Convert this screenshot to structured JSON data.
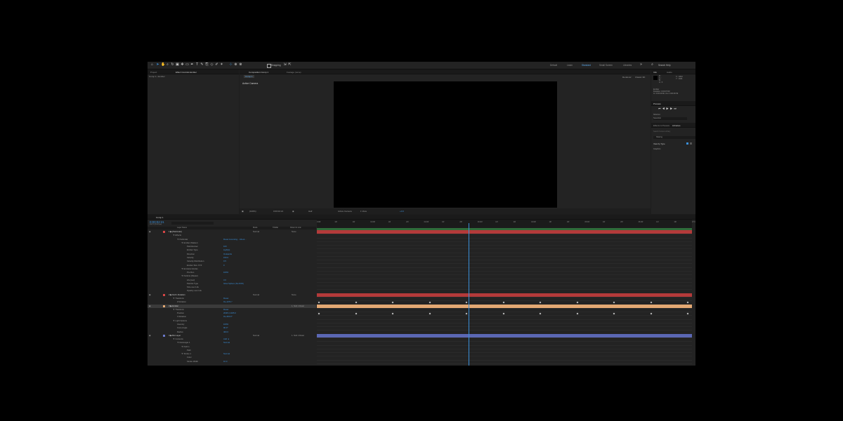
{
  "workspaces": [
    "Default",
    "Learn",
    "Standard",
    "Small Screen",
    "Libraries"
  ],
  "workspace_active": "Standard",
  "search_help": "Search Help",
  "snapping_label": "Snapping",
  "left_panel": {
    "tab_project": "Project",
    "tab_effect_controls": "Effect Controls Emitter",
    "breadcrumb": "Comp 1 • Emitter"
  },
  "comp_panel": {
    "tab_comp": "Composition Comp 1",
    "tab_footage": "Footage (none)",
    "comp_chip": "Comp 1",
    "active_camera": "Active Camera",
    "renderer_label": "Renderer:",
    "renderer_value": "Classic 3D",
    "zoom": "(100%)",
    "timecode": "0:00:02:21",
    "resolution": "Half",
    "view": "Active Camera",
    "views": "1 View",
    "exposure": "+0.0"
  },
  "right_panel": {
    "tab_info": "Info",
    "tab_audio": "Audio",
    "info_r": "R :",
    "info_g": "G :",
    "info_b": "B :",
    "info_a": "A : 0",
    "info_x": "X : 1824",
    "info_y": "Y : 1601",
    "info_name": "Emitter",
    "info_duration": "Duration: 0:00:07:00",
    "info_inout": "In: 0:00:00:00, Out: 0:00:06:59",
    "tab_preview": "Preview",
    "shortcut_label": "Shortcut",
    "shortcut_value": "Spacebar",
    "tab_fx": "Effects & Presets",
    "tab_libraries": "Libraries",
    "lib_search": "Search Current Library",
    "lib_name": "Sharing",
    "view_by": "View by Type",
    "lib_section": "Graphics"
  },
  "timeline": {
    "tab": "Comp 1",
    "timecode": "0:00:02:21",
    "fps": "00071 (25.00 fps)",
    "search_placeholder": "",
    "col_source": "Layer Name",
    "col_mode": "Mode",
    "col_trkmat": "TrkMat",
    "col_parent": "Parent & Link",
    "ruler": [
      "0:00f",
      "10f",
      "20f",
      "01:00f",
      "10f",
      "20f",
      "02:00f",
      "10f",
      "20f",
      "03:00f",
      "10f",
      "20f",
      "04:00f",
      "10f",
      "20f",
      "05:00f",
      "10f",
      "20f",
      "06:00f",
      "10f",
      "20f",
      "07:0"
    ],
    "rows": [
      {
        "indent": 8,
        "label": "1  ▶ [Particular]",
        "value": "",
        "mode": "Normal",
        "parent": "None",
        "color": "#d64545",
        "layer": true
      },
      {
        "indent": 14,
        "label": "▼ Effects",
        "value": ""
      },
      {
        "indent": 20,
        "label": "▼ Particular",
        "value": "Reset   Licensing...   About..."
      },
      {
        "indent": 26,
        "label": "▼ Emitter (Master)",
        "value": ""
      },
      {
        "indent": 34,
        "label": "Particles/sec",
        "value": "100"
      },
      {
        "indent": 34,
        "label": "Emitter Type",
        "value": "Light(s)"
      },
      {
        "indent": 34,
        "label": "Direction",
        "value": "Outwards"
      },
      {
        "indent": 34,
        "label": "Velocity",
        "value": "150.0"
      },
      {
        "indent": 34,
        "label": "Velocity Distribution",
        "value": "0.5"
      },
      {
        "indent": 34,
        "label": "Emitter Size XYZ",
        "value": "0"
      },
      {
        "indent": 26,
        "label": "▼ Emission Extras",
        "value": ""
      },
      {
        "indent": 34,
        "label": "Pre Run",
        "value": "100%"
      },
      {
        "indent": 26,
        "label": "▼ Particle (Master)",
        "value": ""
      },
      {
        "indent": 34,
        "label": "Life [sec]",
        "value": "3.0"
      },
      {
        "indent": 34,
        "label": "Particle Type",
        "value": "Glow Sphere (No DOF)"
      },
      {
        "indent": 34,
        "label": "Size over Life",
        "value": ""
      },
      {
        "indent": 34,
        "label": "Opacity over Life",
        "value": ""
      },
      {
        "indent": 8,
        "label": "2  ▶ Null 1 Rotation",
        "value": "",
        "mode": "Normal",
        "parent": "None",
        "color": "#d64545",
        "layer": true
      },
      {
        "indent": 14,
        "label": "▼ Transform",
        "value": "Reset"
      },
      {
        "indent": 20,
        "label": "Z Rotation",
        "value": "0x+125.1°"
      },
      {
        "indent": 8,
        "label": "3  ▶ Emitter",
        "value": "",
        "mode": "",
        "parent": "1. Null 1 Rotat",
        "color": "#e3a873",
        "layer": true,
        "hl": true
      },
      {
        "indent": 14,
        "label": "▼ Transform",
        "value": "Reset"
      },
      {
        "indent": 20,
        "label": "Position",
        "value": "2038.3,1325.0"
      },
      {
        "indent": 20,
        "label": "X Rotation",
        "value": "0x+360.0°"
      },
      {
        "indent": 14,
        "label": "▼ Light Options",
        "value": ""
      },
      {
        "indent": 20,
        "label": "Intensity",
        "value": "100%"
      },
      {
        "indent": 20,
        "label": "Cone Angle",
        "value": "90.0°"
      },
      {
        "indent": 20,
        "label": "Radius",
        "value": "400.0"
      },
      {
        "indent": 8,
        "label": "4  ▶ Bot Layer",
        "value": "",
        "mode": "Normal",
        "parent": "1. Null 1 Rotat",
        "color": "#6a78c9",
        "layer": true
      },
      {
        "indent": 14,
        "label": "▼ Contents",
        "value": "Add: ●"
      },
      {
        "indent": 20,
        "label": "▼ Rectangle 1",
        "value": "Normal"
      },
      {
        "indent": 26,
        "label": "▼ Path 1",
        "value": ""
      },
      {
        "indent": 34,
        "label": "Path",
        "value": ""
      },
      {
        "indent": 26,
        "label": "▼ Stroke 1",
        "value": "Normal"
      },
      {
        "indent": 34,
        "label": "Color",
        "value": ""
      },
      {
        "indent": 34,
        "label": "Stroke Width",
        "value": "10.0"
      }
    ]
  },
  "colors": {
    "accent": "#3a8fd9",
    "red_bar": "#b33a3a",
    "peach_bar": "#e3a873",
    "blue_bar": "#5b68b4",
    "green_bar": "#3b7a44"
  }
}
